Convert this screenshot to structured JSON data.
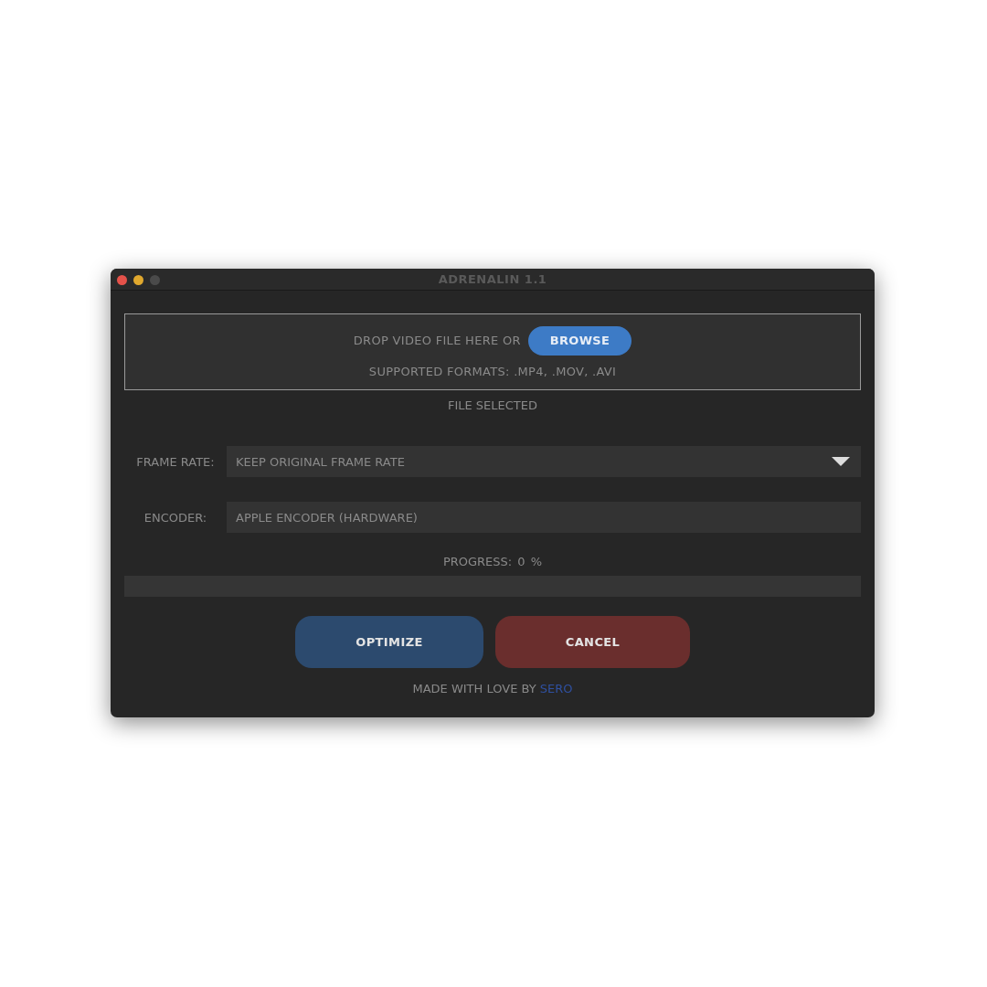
{
  "window": {
    "title": "ADRENALIN 1.1",
    "controls": [
      {
        "color": "#e5524a"
      },
      {
        "color": "#e0a82e"
      },
      {
        "color": "#4a4a4a"
      }
    ]
  },
  "drop_zone": {
    "prompt": "DROP VIDEO FILE HERE OR",
    "button": "BROWSE",
    "formats": "SUPPORTED FORMATS: .MP4, .MOV, .AVI"
  },
  "file_status": "FILE SELECTED",
  "fields": [
    {
      "kind": "dropdown",
      "label": "FRAME RATE:",
      "value": "KEEP ORIGINAL FRAME RATE"
    },
    {
      "kind": "text",
      "label": "ENCODER:",
      "value": "APPLE ENCODER (HARDWARE)"
    }
  ],
  "progress": {
    "label": "PROGRESS:",
    "value": "0",
    "unit": "%"
  },
  "buttons": [
    {
      "kind": "primary",
      "label": "OPTIMIZE"
    },
    {
      "kind": "danger",
      "label": "CANCEL"
    }
  ],
  "footer": {
    "text": "MADE WITH LOVE BY",
    "link": "SERO"
  }
}
